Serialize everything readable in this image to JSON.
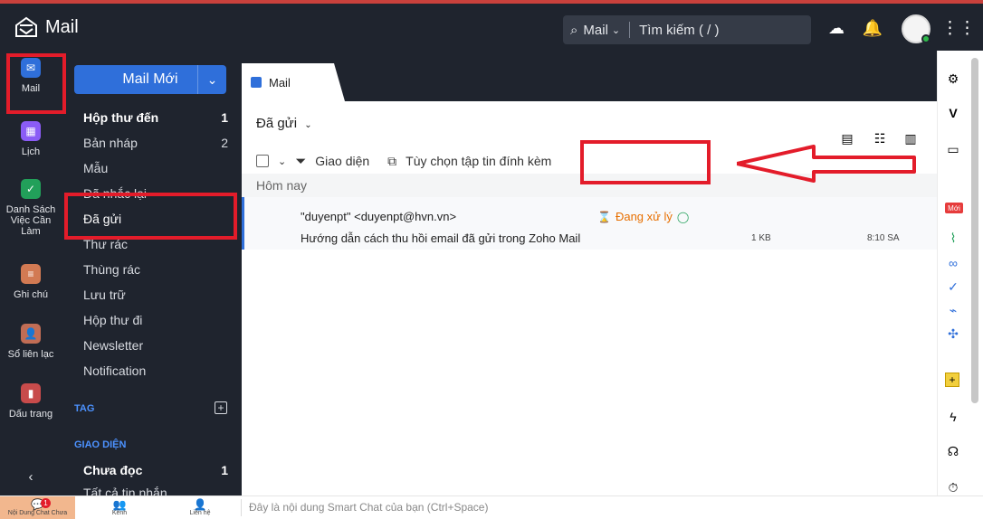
{
  "app": {
    "title": "Mail"
  },
  "topbar": {
    "search_scope": "Mail",
    "search_placeholder": "Tìm kiếm ( / )"
  },
  "left_rail": [
    {
      "label": "Mail",
      "icon": "mail-icon",
      "color": "#2f6fda"
    },
    {
      "label": "Lịch",
      "icon": "calendar-icon",
      "color": "#8b5cf6"
    },
    {
      "label": "Danh Sách Việc Cần Làm",
      "icon": "checklist-icon",
      "color": "#22a05a"
    },
    {
      "label": "Ghi chú",
      "icon": "note-icon",
      "color": "#d27a53"
    },
    {
      "label": "Sổ liên lạc",
      "icon": "contact-icon",
      "color": "#c16d55"
    },
    {
      "label": "Dấu trang",
      "icon": "bookmark-icon",
      "color": "#c84b4b"
    }
  ],
  "sidebar": {
    "compose_label": "Mail Mới",
    "folders": [
      {
        "label": "Hộp thư đến",
        "count": "1",
        "bold": true
      },
      {
        "label": "Bản nháp",
        "count": "2",
        "bold": false
      },
      {
        "label": "Mẫu",
        "count": "",
        "bold": false
      },
      {
        "label": "Đã nhắc lại",
        "count": "",
        "bold": false
      },
      {
        "label": "Đã gửi",
        "count": "",
        "bold": false
      },
      {
        "label": "Thư rác",
        "count": "",
        "bold": false
      },
      {
        "label": "Thùng rác",
        "count": "",
        "bold": false
      },
      {
        "label": "Lưu trữ",
        "count": "",
        "bold": false
      },
      {
        "label": "Hộp thư đi",
        "count": "",
        "bold": false
      },
      {
        "label": "Newsletter",
        "count": "",
        "bold": false
      },
      {
        "label": "Notification",
        "count": "",
        "bold": false
      }
    ],
    "tag_title": "TAG",
    "view_title": "GIAO DIỆN",
    "view_items": [
      {
        "label": "Chưa đọc",
        "count": "1"
      },
      {
        "label": "Tất cả tin nhắn",
        "count": ""
      }
    ],
    "collapse_icon": "chevron-left-icon"
  },
  "main": {
    "tab_label": "Mail",
    "header_title": "Đã gửi",
    "toolbar": {
      "view_label": "Giao diện",
      "attachment_label": "Tùy chọn tập tin đính kèm"
    },
    "section_label": "Hôm nay",
    "emails": [
      {
        "from": "\"duyenpt\" <duyenpt@hvn.vn>",
        "subject": "Hướng dẫn cách thu hồi email đã gửi trong Zoho Mail",
        "status": "Đang xử lý",
        "size": "1 KB",
        "time": "8:10 SA"
      }
    ]
  },
  "right_rail": {
    "new_badge": "Mới"
  },
  "bottom": {
    "chat_label": "Nội Dung Chat Chưa",
    "chat_badge": "1",
    "channels_label": "Kênh",
    "contacts_label": "Liên hệ",
    "smart_chat_placeholder": "Đây là nội dung Smart Chat của bạn (Ctrl+Space)"
  },
  "colors": {
    "dark_bg": "#1f242e",
    "accent": "#2f6fda",
    "highlight_red": "#e31c2a",
    "status_orange": "#e76f00"
  }
}
